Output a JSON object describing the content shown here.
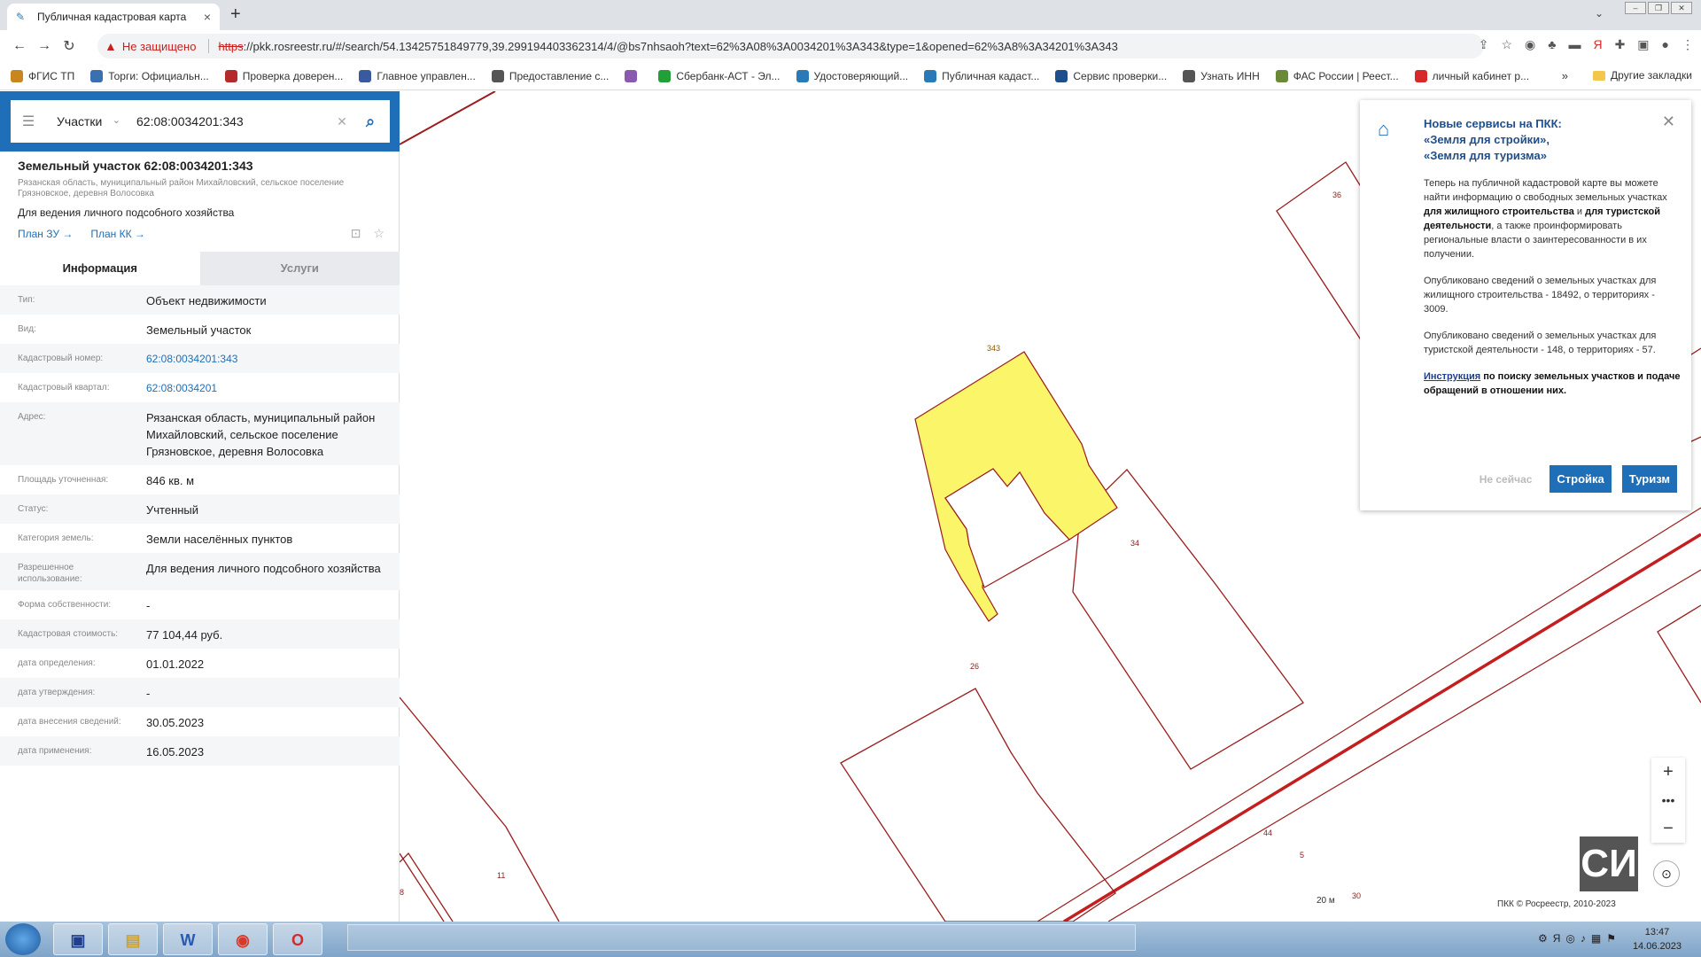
{
  "browser": {
    "tab_title": "Публичная кадастровая карта",
    "tab_close": "×",
    "new_tab": "+",
    "security_label": "Не защищено",
    "url_scheme": "https",
    "url_rest": "://pkk.rosreestr.ru/#/search/54.13425751849779,39.299194403362314/4/@bs7nhsaoh?text=62%3A08%3A0034201%3A343&type=1&opened=62%3A8%3A34201%3A343"
  },
  "bookmarks": [
    {
      "label": "ФГИС ТП",
      "color": "#c8861e"
    },
    {
      "label": "Торги: Официальн...",
      "color": "#3a6fb0"
    },
    {
      "label": "Проверка доверен...",
      "color": "#b52a2a"
    },
    {
      "label": "Главное управлен...",
      "color": "#3a5aa0"
    },
    {
      "label": "Предоставление с...",
      "color": "#555555"
    },
    {
      "label": "",
      "color": "#8a5ab0"
    },
    {
      "label": "Сбербанк-АСТ - Эл...",
      "color": "#21a038"
    },
    {
      "label": "Удостоверяющий...",
      "color": "#2a7ab8"
    },
    {
      "label": "Публичная кадаст...",
      "color": "#2a7ab8"
    },
    {
      "label": "Сервис проверки...",
      "color": "#1f4f8b"
    },
    {
      "label": "Узнать ИНН",
      "color": "#555555"
    },
    {
      "label": "ФАС России | Реест...",
      "color": "#6a8a3a"
    },
    {
      "label": "личный кабинет р...",
      "color": "#d62a2a"
    }
  ],
  "bookmarks_more": "»",
  "bookmarks_other": "Другие закладки",
  "search": {
    "type_label": "Участки",
    "query": "62:08:0034201:343"
  },
  "object": {
    "title": "Земельный участок 62:08:0034201:343",
    "address_short": "Рязанская область, муниципальный район Михайловский, сельское поселение Грязновское, деревня Волосовка",
    "use": "Для ведения личного подсобного хозяйства",
    "link_zu": "План ЗУ →",
    "link_kk": "План КК →"
  },
  "tabs": {
    "info": "Информация",
    "services": "Услуги"
  },
  "fields": [
    {
      "key": "Тип:",
      "value": "Объект недвижимости"
    },
    {
      "key": "Вид:",
      "value": "Земельный участок"
    },
    {
      "key": "Кадастровый номер:",
      "value": "62:08:0034201:343",
      "link": true
    },
    {
      "key": "Кадастровый квартал:",
      "value": "62:08:0034201",
      "link": true
    },
    {
      "key": "Адрес:",
      "value": "Рязанская область, муниципальный район Михайловский, сельское поселение Грязновское, деревня Волосовка"
    },
    {
      "key": "Площадь уточненная:",
      "value": "846 кв. м"
    },
    {
      "key": "Статус:",
      "value": "Учтенный"
    },
    {
      "key": "Категория земель:",
      "value": "Земли населённых пунктов"
    },
    {
      "key": "Разрешенное использование:",
      "value": "Для ведения личного подсобного хозяйства"
    },
    {
      "key": "Форма собственности:",
      "value": "-"
    },
    {
      "key": "Кадастровая стоимость:",
      "value": "77 104,44 руб."
    },
    {
      "key": "дата определения:",
      "value": "01.01.2022"
    },
    {
      "key": "дата утверждения:",
      "value": "-"
    },
    {
      "key": "дата внесения сведений:",
      "value": "30.05.2023"
    },
    {
      "key": "дата применения:",
      "value": "16.05.2023"
    }
  ],
  "map": {
    "parcel_labels": [
      "343",
      "34",
      "26",
      "36",
      "11",
      "44",
      "5",
      "8",
      "30"
    ],
    "highlight_color": "#fbf56a",
    "boundary_color": "#9b1c1c",
    "copyright": "ПКК © Росреестр, 2010-2023",
    "scale": "20 м"
  },
  "popup": {
    "title_l1": "Новые сервисы на ПКК:",
    "title_l2": "«Земля для стройки»,",
    "title_l3": "«Земля для туризма»",
    "p1_pre": "Теперь на публичной кадастровой карте вы можете найти информацию о свободных земельных участках",
    "p1_b1": "для жилищного строительства",
    "p1_mid": "и",
    "p1_b2": "для туристской деятельности",
    "p1_post": ", а также проинформировать региональные власти о заинтересованности в их получении.",
    "p2": "Опубликовано сведений о земельных участках для жилищного строительства - 18492, о территориях - 3009.",
    "p3": "Опубликовано сведений о земельных участках для туристской деятельности - 148, о территориях - 57.",
    "p4_link": "Инструкция",
    "p4_rest": "по поиску земельных участков и подаче обращений в отношении них.",
    "btn_later": "Не сейчас",
    "btn_build": "Стройка",
    "btn_tourism": "Туризм"
  },
  "taskbar": {
    "time": "13:47",
    "date": "14.06.2023"
  }
}
